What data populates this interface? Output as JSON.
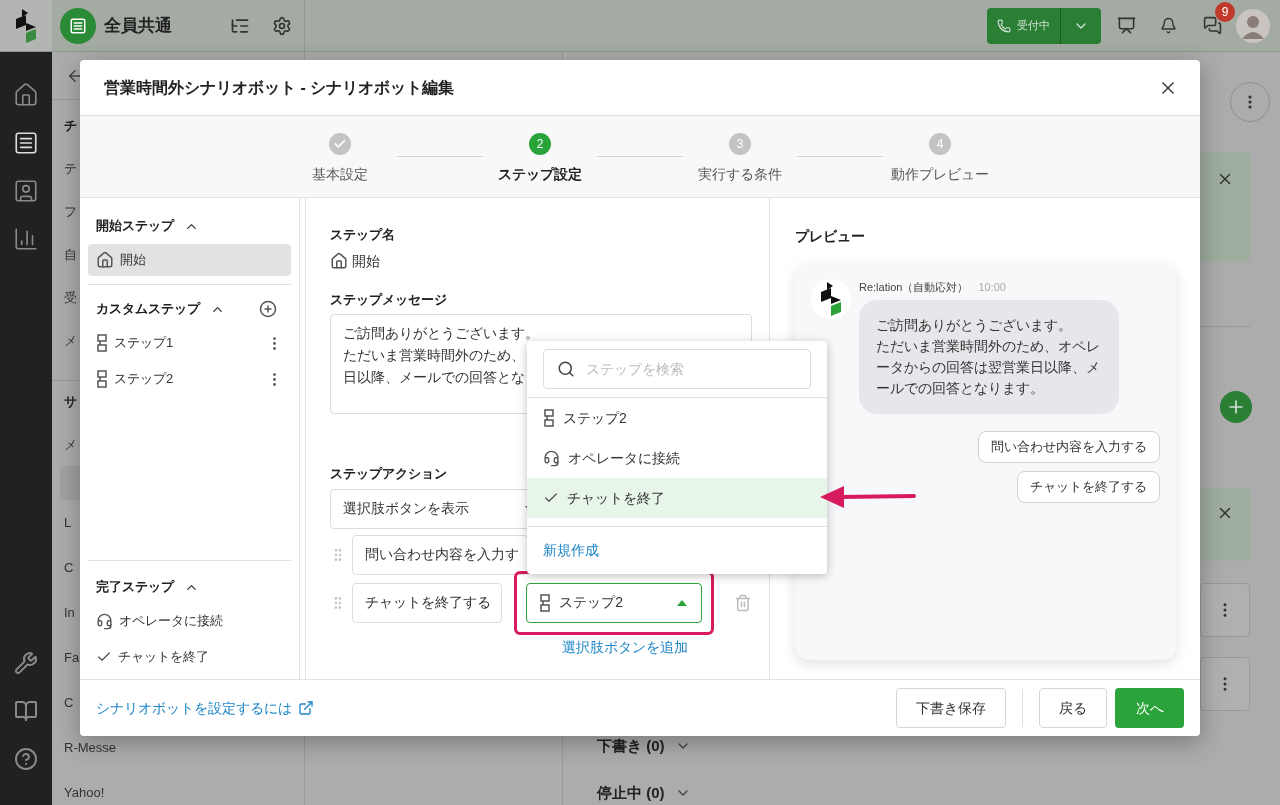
{
  "top_bar": {
    "workspace": "全員共通",
    "status_button": "受付中",
    "notification_count": "9"
  },
  "rail": {
    "items": [
      {
        "selected": false
      },
      {
        "selected": true
      },
      {
        "selected": false
      },
      {
        "selected": false
      }
    ]
  },
  "side_list": {
    "items": [
      {
        "kind": "header",
        "label": "チ"
      },
      {
        "kind": "item",
        "label": "テ"
      },
      {
        "kind": "item",
        "label": "フ"
      },
      {
        "kind": "item",
        "label": "自"
      },
      {
        "kind": "item",
        "label": "受"
      },
      {
        "kind": "item",
        "label": "メ"
      },
      {
        "kind": "header",
        "label": "サ"
      },
      {
        "kind": "item",
        "label": "メ"
      },
      {
        "kind": "active"
      },
      {
        "kind": "item",
        "label": "L"
      },
      {
        "kind": "item",
        "label": "C"
      },
      {
        "kind": "item",
        "label": "In"
      },
      {
        "kind": "item",
        "label": "Fa"
      },
      {
        "kind": "item",
        "label": "C"
      },
      {
        "kind": "item",
        "label": "R-Messe"
      },
      {
        "kind": "item",
        "label": "Yahoo!"
      }
    ]
  },
  "bot_groups": [
    {
      "label": "下書き (0)",
      "expanded": false
    },
    {
      "label": "停止中 (0)",
      "expanded": false
    }
  ],
  "modal": {
    "title": "営業時間外シナリオボット - シナリオボット編集",
    "steps": [
      {
        "label": "基本設定",
        "kind": "done"
      },
      {
        "label": "ステップ設定",
        "number": "2",
        "kind": "current"
      },
      {
        "label": "実行する条件",
        "number": "3",
        "kind": "todo"
      },
      {
        "label": "動作プレビュー",
        "number": "4",
        "kind": "todo"
      }
    ],
    "sidebar": {
      "sections": [
        {
          "title": "開始ステップ",
          "expanded": true,
          "items": [
            {
              "label": "開始",
              "kind": "start",
              "selected": true
            }
          ]
        },
        {
          "title": "カスタムステップ",
          "expanded": true,
          "addable": true,
          "items": [
            {
              "label": "ステップ1",
              "kind": "step",
              "selected": false
            },
            {
              "label": "ステップ2",
              "kind": "step",
              "selected": false
            }
          ]
        },
        {
          "title": "完了ステップ",
          "expanded": true,
          "items": [
            {
              "label": "オペレータに接続",
              "kind": "operator",
              "selected": false
            },
            {
              "label": "チャットを終了",
              "kind": "end",
              "selected": false
            }
          ]
        }
      ]
    },
    "editor": {
      "step_name_label": "ステップ名",
      "step_name": "開始",
      "message_label": "ステップメッセージ",
      "message_lines": [
        "ご訪問ありがとうございます。",
        "ただいま営業時間外のため、",
        "日以降、メールでの回答とな"
      ],
      "action_label": "ステップアクション",
      "action_select": "選択肢ボタンを表示",
      "choices": [
        {
          "text": "問い合わせ内容を入力す"
        },
        {
          "text": "チャットを終了する",
          "target": "ステップ2",
          "open": true
        }
      ],
      "add_choice_link": "選択肢ボタンを追加"
    },
    "dropdown": {
      "search_placeholder": "ステップを検索",
      "items": [
        {
          "label": "ステップ2",
          "kind": "step",
          "selected": false
        },
        {
          "label": "オペレータに接続",
          "kind": "operator",
          "selected": false
        },
        {
          "label": "チャットを終了",
          "kind": "end",
          "selected": true
        }
      ],
      "create_link": "新規作成"
    },
    "preview": {
      "title": "プレビュー",
      "bot_name": "Re:lation（自動応対）",
      "time": "10:00",
      "message": [
        "ご訪問ありがとうございます。",
        "ただいま営業時間外のため、オペレータからの回答は翌営業日以降、メールでの回答となります。"
      ],
      "choices": [
        "問い合わせ内容を入力する",
        "チャットを終了する"
      ]
    },
    "footer": {
      "help_link": "シナリオボットを設定するには",
      "buttons": [
        {
          "label": "下書き保存",
          "kind": "secondary"
        },
        {
          "label": "戻る",
          "kind": "secondary"
        },
        {
          "label": "次へ",
          "kind": "primary"
        }
      ]
    }
  }
}
